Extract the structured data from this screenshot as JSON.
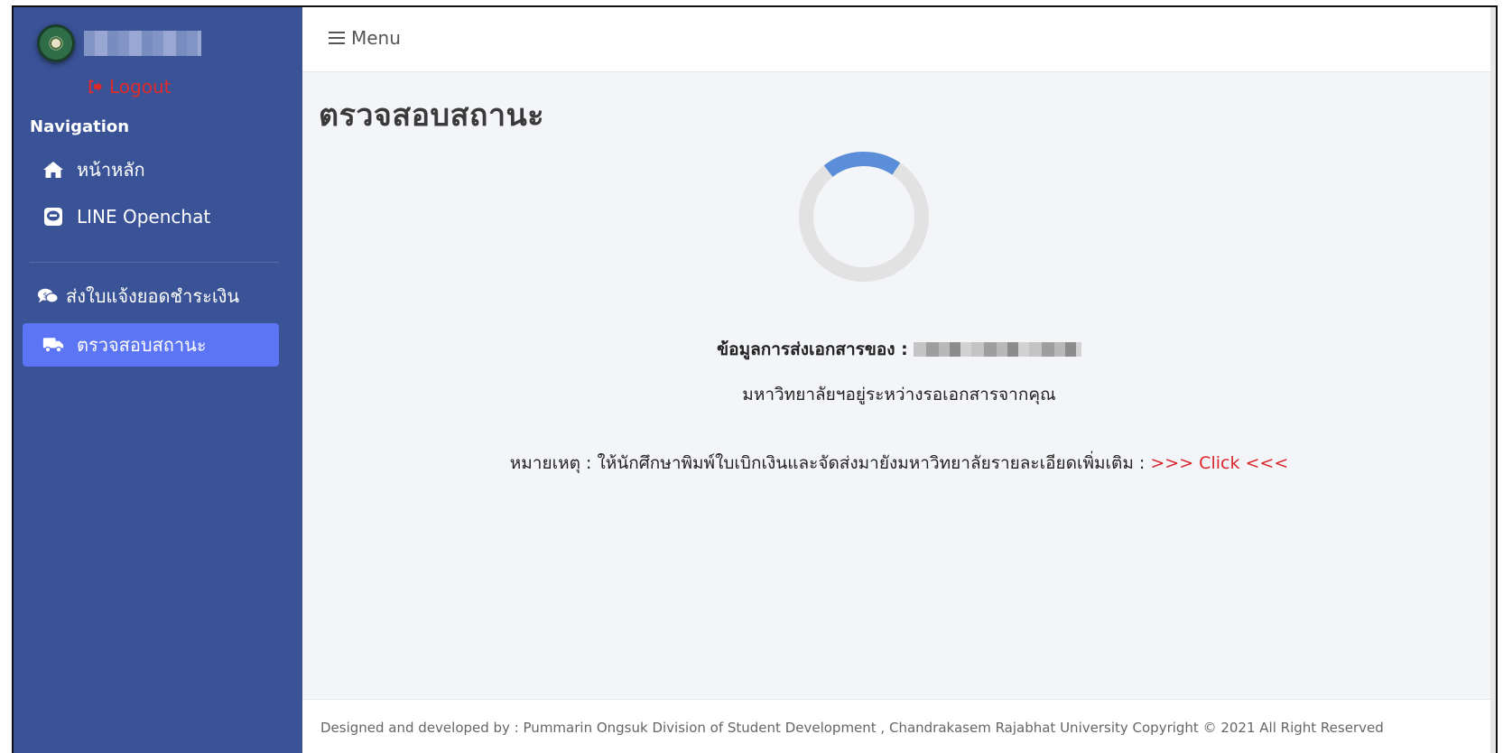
{
  "sidebar": {
    "logout_label": "Logout",
    "nav_heading": "Navigation",
    "items": [
      {
        "label": "หน้าหลัก",
        "icon": "home-icon"
      },
      {
        "label": "LINE Openchat",
        "icon": "line-icon"
      },
      {
        "label": "ส่งใบแจ้งยอดชำระเงิน",
        "icon": "comments-dollar-icon"
      },
      {
        "label": "ตรวจสอบสถานะ",
        "icon": "truck-icon",
        "active": true
      }
    ]
  },
  "header": {
    "menu_label": "Menu"
  },
  "main": {
    "page_title": "ตรวจสอบสถานะ",
    "progress_fraction": 0.2,
    "spinner_colors": {
      "track": "#e2e2e2",
      "arc": "#5b8ed8"
    },
    "info_label": "ข้อมูลการส่งเอกสารของ :",
    "status_text": "มหาวิทยาลัยฯอยู่ระหว่างรอเอกสารจากคุณ",
    "note_text": "หมายเหตุ : ให้นักศึกษาพิมพ์ใบเบิกเงินและจัดส่งมายังมหาวิทยาลัยรายละเอียดเพิ่มเติม :",
    "click_link": ">>> Click <<<"
  },
  "footer": {
    "text": "Designed and developed by : Pummarin Ongsuk Division of Student Development , Chandrakasem Rajabhat University Copyright © 2021 All Right Reserved"
  },
  "colors": {
    "sidebar_bg": "#3a5296",
    "active_item": "#5b75f4",
    "logout": "#e12b2b",
    "link": "#d9262b"
  }
}
